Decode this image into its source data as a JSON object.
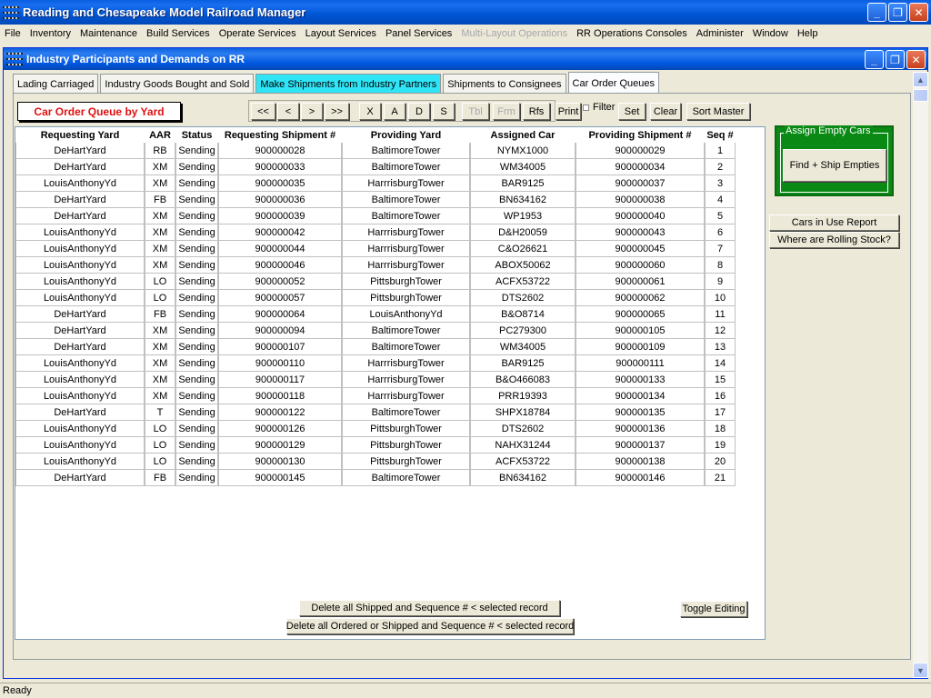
{
  "app": {
    "title": "Reading and Chesapeake Model Railroad Manager"
  },
  "window_buttons": {
    "minimize": "_",
    "restore": "❐",
    "close": "✕"
  },
  "menu": [
    {
      "label": "File",
      "enabled": true
    },
    {
      "label": "Inventory",
      "enabled": true
    },
    {
      "label": "Maintenance",
      "enabled": true
    },
    {
      "label": "Build Services",
      "enabled": true
    },
    {
      "label": "Operate Services",
      "enabled": true
    },
    {
      "label": "Layout Services",
      "enabled": true
    },
    {
      "label": "Panel Services",
      "enabled": true
    },
    {
      "label": "Multi-Layout Operations",
      "enabled": false
    },
    {
      "label": "RR Operations Consoles",
      "enabled": true
    },
    {
      "label": "Administer",
      "enabled": true
    },
    {
      "label": "Window",
      "enabled": true
    },
    {
      "label": "Help",
      "enabled": true
    }
  ],
  "child_window": {
    "title": "Industry Participants and Demands on RR"
  },
  "tabs": [
    {
      "label": "Lading Carriaged",
      "state": "normal"
    },
    {
      "label": "Industry Goods Bought and Sold",
      "state": "normal"
    },
    {
      "label": "Make Shipments from Industry Partners",
      "state": "highlight"
    },
    {
      "label": "Shipments to Consignees",
      "state": "normal"
    },
    {
      "label": "Car Order Queues",
      "state": "active"
    }
  ],
  "panel": {
    "queue_label": "Car Order Queue by Yard",
    "nav_buttons": {
      "first": "<<",
      "prev": "<",
      "next": ">",
      "last": ">>",
      "x": "X",
      "a": "A",
      "d": "D",
      "s": "S",
      "tbl": "Tbl",
      "frm": "Frm",
      "rfs": "Rfs"
    },
    "print": "Print",
    "filter": "Filter",
    "set": "Set",
    "clear": "Clear",
    "sort_master": "Sort Master",
    "delete_shipped": "Delete all Shipped and Sequence # < selected record",
    "delete_ordered": "Delete all Ordered or Shipped and Sequence # < selected record",
    "toggle_editing": "Toggle Editing"
  },
  "side_panel": {
    "assign_legend": "Assign Empty Cars",
    "find_ship": "Find + Ship Empties",
    "cars_in_use": "Cars in Use Report",
    "rolling_stock": "Where are Rolling Stock?"
  },
  "table": {
    "columns": [
      "Requesting Yard",
      "AAR",
      "Status",
      "Requesting Shipment #",
      "Providing Yard",
      "Assigned Car",
      "Providing Shipment #",
      "Seq #"
    ],
    "rows": [
      [
        "DeHartYard",
        "RB",
        "Sending",
        "900000028",
        "BaltimoreTower",
        "NYMX1000",
        "900000029",
        "1"
      ],
      [
        "DeHartYard",
        "XM",
        "Sending",
        "900000033",
        "BaltimoreTower",
        "WM34005",
        "900000034",
        "2"
      ],
      [
        "LouisAnthonyYd",
        "XM",
        "Sending",
        "900000035",
        "HarrrisburgTower",
        "BAR9125",
        "900000037",
        "3"
      ],
      [
        "DeHartYard",
        "FB",
        "Sending",
        "900000036",
        "BaltimoreTower",
        "BN634162",
        "900000038",
        "4"
      ],
      [
        "DeHartYard",
        "XM",
        "Sending",
        "900000039",
        "BaltimoreTower",
        "WP1953",
        "900000040",
        "5"
      ],
      [
        "LouisAnthonyYd",
        "XM",
        "Sending",
        "900000042",
        "HarrrisburgTower",
        "D&H20059",
        "900000043",
        "6"
      ],
      [
        "LouisAnthonyYd",
        "XM",
        "Sending",
        "900000044",
        "HarrrisburgTower",
        "C&O26621",
        "900000045",
        "7"
      ],
      [
        "LouisAnthonyYd",
        "XM",
        "Sending",
        "900000046",
        "HarrrisburgTower",
        "ABOX50062",
        "900000060",
        "8"
      ],
      [
        "LouisAnthonyYd",
        "LO",
        "Sending",
        "900000052",
        "PittsburghTower",
        "ACFX53722",
        "900000061",
        "9"
      ],
      [
        "LouisAnthonyYd",
        "LO",
        "Sending",
        "900000057",
        "PittsburghTower",
        "DTS2602",
        "900000062",
        "10"
      ],
      [
        "DeHartYard",
        "FB",
        "Sending",
        "900000064",
        "LouisAnthonyYd",
        "B&O8714",
        "900000065",
        "11"
      ],
      [
        "DeHartYard",
        "XM",
        "Sending",
        "900000094",
        "BaltimoreTower",
        "PC279300",
        "900000105",
        "12"
      ],
      [
        "DeHartYard",
        "XM",
        "Sending",
        "900000107",
        "BaltimoreTower",
        "WM34005",
        "900000109",
        "13"
      ],
      [
        "LouisAnthonyYd",
        "XM",
        "Sending",
        "900000110",
        "HarrrisburgTower",
        "BAR9125",
        "900000111",
        "14"
      ],
      [
        "LouisAnthonyYd",
        "XM",
        "Sending",
        "900000117",
        "HarrrisburgTower",
        "B&O466083",
        "900000133",
        "15"
      ],
      [
        "LouisAnthonyYd",
        "XM",
        "Sending",
        "900000118",
        "HarrrisburgTower",
        "PRR19393",
        "900000134",
        "16"
      ],
      [
        "DeHartYard",
        "T",
        "Sending",
        "900000122",
        "BaltimoreTower",
        "SHPX18784",
        "900000135",
        "17"
      ],
      [
        "LouisAnthonyYd",
        "LO",
        "Sending",
        "900000126",
        "PittsburghTower",
        "DTS2602",
        "900000136",
        "18"
      ],
      [
        "LouisAnthonyYd",
        "LO",
        "Sending",
        "900000129",
        "PittsburghTower",
        "NAHX31244",
        "900000137",
        "19"
      ],
      [
        "LouisAnthonyYd",
        "LO",
        "Sending",
        "900000130",
        "PittsburghTower",
        "ACFX53722",
        "900000138",
        "20"
      ],
      [
        "DeHartYard",
        "FB",
        "Sending",
        "900000145",
        "BaltimoreTower",
        "BN634162",
        "900000146",
        "21"
      ]
    ]
  },
  "status_bar": {
    "text": "Ready"
  },
  "colors": {
    "titlebar": "#0055d4",
    "tab_highlight": "#2fe4f5",
    "queue_label_text": "#e01010",
    "assign_box": "#0a8a14"
  }
}
